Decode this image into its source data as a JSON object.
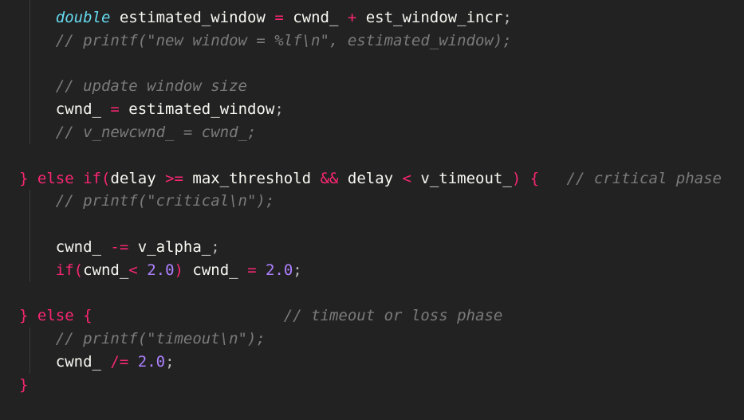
{
  "theme": {
    "background": "#222222",
    "colors": {
      "plain": "#f8f8f2",
      "keyword": "#f92672",
      "type": "#66d9ef",
      "number": "#ae81ff",
      "comment": "#7b7b7b",
      "punct": "#b8b8b8"
    }
  },
  "code": {
    "lines": [
      {
        "tokens": [
          {
            "t": "    "
          },
          {
            "t": "double",
            "c": "type",
            "i": true
          },
          {
            "t": " estimated_window "
          },
          {
            "t": "=",
            "c": "keyword"
          },
          {
            "t": " cwnd_ "
          },
          {
            "t": "+",
            "c": "keyword"
          },
          {
            "t": " est_window_incr"
          },
          {
            "t": ";",
            "c": "punct"
          }
        ]
      },
      {
        "tokens": [
          {
            "t": "    "
          },
          {
            "t": "// printf(\"new window = %lf\\n\", estimated_window);",
            "c": "comment",
            "i": true
          }
        ]
      },
      {
        "tokens": []
      },
      {
        "tokens": [
          {
            "t": "    "
          },
          {
            "t": "// update window size",
            "c": "comment",
            "i": true
          }
        ]
      },
      {
        "tokens": [
          {
            "t": "    "
          },
          {
            "t": "cwnd_ "
          },
          {
            "t": "=",
            "c": "keyword"
          },
          {
            "t": " estimated_window"
          },
          {
            "t": ";",
            "c": "punct"
          }
        ]
      },
      {
        "tokens": [
          {
            "t": "    "
          },
          {
            "t": "// v_newcwnd_ = cwnd_;",
            "c": "comment",
            "i": true
          }
        ]
      },
      {
        "tokens": []
      },
      {
        "tokens": [
          {
            "t": "} ",
            "c": "keyword"
          },
          {
            "t": "else",
            "c": "keyword"
          },
          {
            "t": " "
          },
          {
            "t": "if(",
            "c": "keyword"
          },
          {
            "t": "delay "
          },
          {
            "t": ">=",
            "c": "keyword"
          },
          {
            "t": " max_threshold "
          },
          {
            "t": "&&",
            "c": "keyword"
          },
          {
            "t": " delay "
          },
          {
            "t": "<",
            "c": "keyword"
          },
          {
            "t": " v_timeout_"
          },
          {
            "t": ")",
            "c": "keyword"
          },
          {
            "t": " "
          },
          {
            "t": "{",
            "c": "keyword"
          },
          {
            "t": "   "
          },
          {
            "t": "// critical phase",
            "c": "comment",
            "i": true
          }
        ]
      },
      {
        "tokens": [
          {
            "t": "    "
          },
          {
            "t": "// printf(\"critical\\n\");",
            "c": "comment",
            "i": true
          }
        ]
      },
      {
        "tokens": []
      },
      {
        "tokens": [
          {
            "t": "    "
          },
          {
            "t": "cwnd_ "
          },
          {
            "t": "-=",
            "c": "keyword"
          },
          {
            "t": " v_alpha_"
          },
          {
            "t": ";",
            "c": "punct"
          }
        ]
      },
      {
        "tokens": [
          {
            "t": "    "
          },
          {
            "t": "if(",
            "c": "keyword"
          },
          {
            "t": "cwnd_"
          },
          {
            "t": "<",
            "c": "keyword"
          },
          {
            "t": " "
          },
          {
            "t": "2.0",
            "c": "number"
          },
          {
            "t": ")",
            "c": "keyword"
          },
          {
            "t": " cwnd_ "
          },
          {
            "t": "=",
            "c": "keyword"
          },
          {
            "t": " "
          },
          {
            "t": "2.0",
            "c": "number"
          },
          {
            "t": ";",
            "c": "punct"
          }
        ]
      },
      {
        "tokens": []
      },
      {
        "tokens": [
          {
            "t": "} ",
            "c": "keyword"
          },
          {
            "t": "else",
            "c": "keyword"
          },
          {
            "t": " "
          },
          {
            "t": "{",
            "c": "keyword"
          },
          {
            "t": "                     "
          },
          {
            "t": "// timeout or loss phase",
            "c": "comment",
            "i": true
          }
        ]
      },
      {
        "tokens": [
          {
            "t": "    "
          },
          {
            "t": "// printf(\"timeout\\n\");",
            "c": "comment",
            "i": true
          }
        ]
      },
      {
        "tokens": [
          {
            "t": "    "
          },
          {
            "t": "cwnd_ "
          },
          {
            "t": "/=",
            "c": "keyword"
          },
          {
            "t": " "
          },
          {
            "t": "2.0",
            "c": "number"
          },
          {
            "t": ";",
            "c": "punct"
          }
        ]
      },
      {
        "tokens": [
          {
            "t": "}",
            "c": "keyword"
          }
        ]
      }
    ]
  }
}
